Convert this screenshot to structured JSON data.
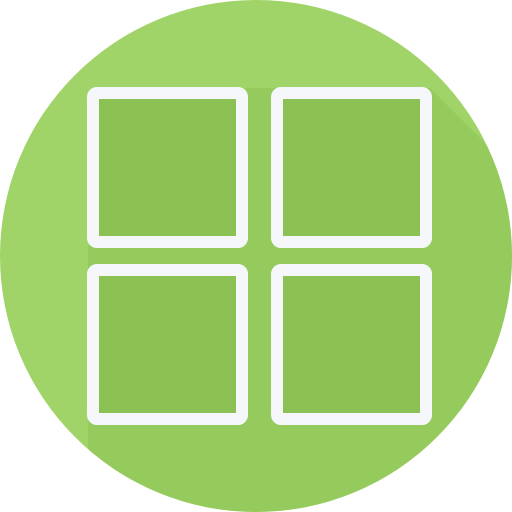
{
  "icon": {
    "name": "grid-view-icon",
    "background_color": "#a0d468",
    "shadow_color": "#8cc153",
    "tile_fill_color": "#8cc153",
    "tile_stroke_color": "#f5f7fa"
  },
  "tiles": [
    {
      "name": "tile-top-left"
    },
    {
      "name": "tile-top-right"
    },
    {
      "name": "tile-bottom-left"
    },
    {
      "name": "tile-bottom-right"
    }
  ]
}
